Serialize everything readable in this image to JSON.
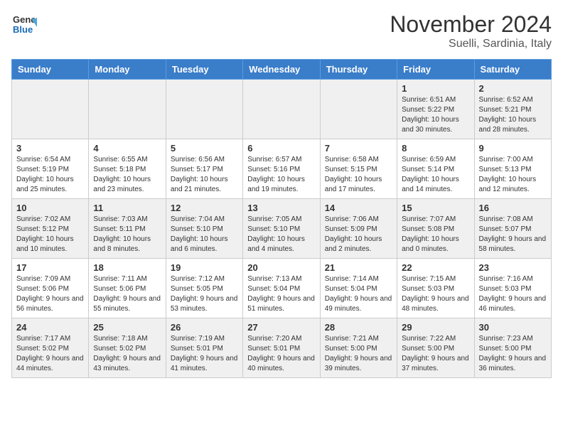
{
  "logo": {
    "line1": "General",
    "line2": "Blue"
  },
  "title": "November 2024",
  "subtitle": "Suelli, Sardinia, Italy",
  "days_header": [
    "Sunday",
    "Monday",
    "Tuesday",
    "Wednesday",
    "Thursday",
    "Friday",
    "Saturday"
  ],
  "weeks": [
    [
      {
        "day": "",
        "info": ""
      },
      {
        "day": "",
        "info": ""
      },
      {
        "day": "",
        "info": ""
      },
      {
        "day": "",
        "info": ""
      },
      {
        "day": "",
        "info": ""
      },
      {
        "day": "1",
        "info": "Sunrise: 6:51 AM\nSunset: 5:22 PM\nDaylight: 10 hours and 30 minutes."
      },
      {
        "day": "2",
        "info": "Sunrise: 6:52 AM\nSunset: 5:21 PM\nDaylight: 10 hours and 28 minutes."
      }
    ],
    [
      {
        "day": "3",
        "info": "Sunrise: 6:54 AM\nSunset: 5:19 PM\nDaylight: 10 hours and 25 minutes."
      },
      {
        "day": "4",
        "info": "Sunrise: 6:55 AM\nSunset: 5:18 PM\nDaylight: 10 hours and 23 minutes."
      },
      {
        "day": "5",
        "info": "Sunrise: 6:56 AM\nSunset: 5:17 PM\nDaylight: 10 hours and 21 minutes."
      },
      {
        "day": "6",
        "info": "Sunrise: 6:57 AM\nSunset: 5:16 PM\nDaylight: 10 hours and 19 minutes."
      },
      {
        "day": "7",
        "info": "Sunrise: 6:58 AM\nSunset: 5:15 PM\nDaylight: 10 hours and 17 minutes."
      },
      {
        "day": "8",
        "info": "Sunrise: 6:59 AM\nSunset: 5:14 PM\nDaylight: 10 hours and 14 minutes."
      },
      {
        "day": "9",
        "info": "Sunrise: 7:00 AM\nSunset: 5:13 PM\nDaylight: 10 hours and 12 minutes."
      }
    ],
    [
      {
        "day": "10",
        "info": "Sunrise: 7:02 AM\nSunset: 5:12 PM\nDaylight: 10 hours and 10 minutes."
      },
      {
        "day": "11",
        "info": "Sunrise: 7:03 AM\nSunset: 5:11 PM\nDaylight: 10 hours and 8 minutes."
      },
      {
        "day": "12",
        "info": "Sunrise: 7:04 AM\nSunset: 5:10 PM\nDaylight: 10 hours and 6 minutes."
      },
      {
        "day": "13",
        "info": "Sunrise: 7:05 AM\nSunset: 5:10 PM\nDaylight: 10 hours and 4 minutes."
      },
      {
        "day": "14",
        "info": "Sunrise: 7:06 AM\nSunset: 5:09 PM\nDaylight: 10 hours and 2 minutes."
      },
      {
        "day": "15",
        "info": "Sunrise: 7:07 AM\nSunset: 5:08 PM\nDaylight: 10 hours and 0 minutes."
      },
      {
        "day": "16",
        "info": "Sunrise: 7:08 AM\nSunset: 5:07 PM\nDaylight: 9 hours and 58 minutes."
      }
    ],
    [
      {
        "day": "17",
        "info": "Sunrise: 7:09 AM\nSunset: 5:06 PM\nDaylight: 9 hours and 56 minutes."
      },
      {
        "day": "18",
        "info": "Sunrise: 7:11 AM\nSunset: 5:06 PM\nDaylight: 9 hours and 55 minutes."
      },
      {
        "day": "19",
        "info": "Sunrise: 7:12 AM\nSunset: 5:05 PM\nDaylight: 9 hours and 53 minutes."
      },
      {
        "day": "20",
        "info": "Sunrise: 7:13 AM\nSunset: 5:04 PM\nDaylight: 9 hours and 51 minutes."
      },
      {
        "day": "21",
        "info": "Sunrise: 7:14 AM\nSunset: 5:04 PM\nDaylight: 9 hours and 49 minutes."
      },
      {
        "day": "22",
        "info": "Sunrise: 7:15 AM\nSunset: 5:03 PM\nDaylight: 9 hours and 48 minutes."
      },
      {
        "day": "23",
        "info": "Sunrise: 7:16 AM\nSunset: 5:03 PM\nDaylight: 9 hours and 46 minutes."
      }
    ],
    [
      {
        "day": "24",
        "info": "Sunrise: 7:17 AM\nSunset: 5:02 PM\nDaylight: 9 hours and 44 minutes."
      },
      {
        "day": "25",
        "info": "Sunrise: 7:18 AM\nSunset: 5:02 PM\nDaylight: 9 hours and 43 minutes."
      },
      {
        "day": "26",
        "info": "Sunrise: 7:19 AM\nSunset: 5:01 PM\nDaylight: 9 hours and 41 minutes."
      },
      {
        "day": "27",
        "info": "Sunrise: 7:20 AM\nSunset: 5:01 PM\nDaylight: 9 hours and 40 minutes."
      },
      {
        "day": "28",
        "info": "Sunrise: 7:21 AM\nSunset: 5:00 PM\nDaylight: 9 hours and 39 minutes."
      },
      {
        "day": "29",
        "info": "Sunrise: 7:22 AM\nSunset: 5:00 PM\nDaylight: 9 hours and 37 minutes."
      },
      {
        "day": "30",
        "info": "Sunrise: 7:23 AM\nSunset: 5:00 PM\nDaylight: 9 hours and 36 minutes."
      }
    ]
  ]
}
